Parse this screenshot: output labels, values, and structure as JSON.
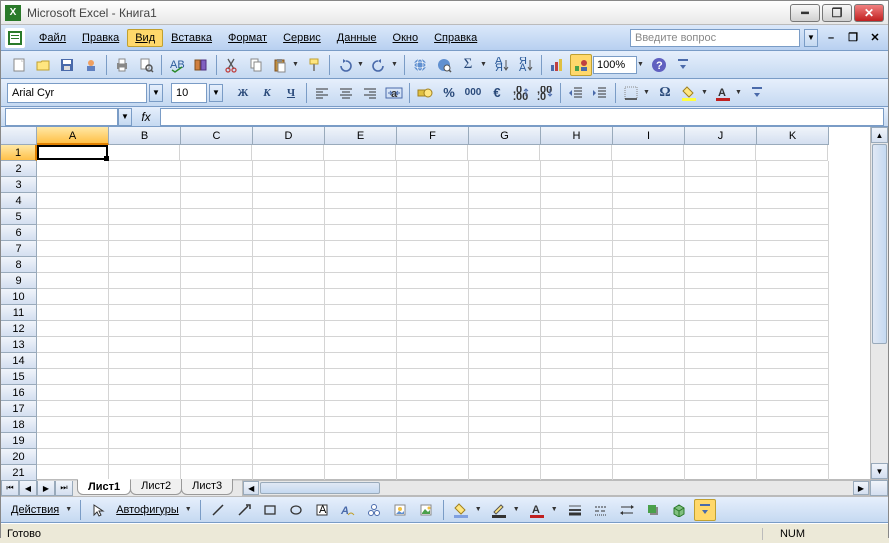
{
  "title": "Microsoft Excel - Книга1",
  "menu": {
    "items": [
      "Файл",
      "Правка",
      "Вид",
      "Вставка",
      "Формат",
      "Сервис",
      "Данные",
      "Окно",
      "Справка"
    ],
    "active_index": 2
  },
  "ask_box": {
    "placeholder": "Введите вопрос"
  },
  "toolbar": {
    "zoom": "100%"
  },
  "format": {
    "font": "Arial Cyr",
    "size": "10"
  },
  "name_box": {
    "value": ""
  },
  "formula": {
    "value": "",
    "fx": "fx"
  },
  "columns": [
    "A",
    "B",
    "C",
    "D",
    "E",
    "F",
    "G",
    "H",
    "I",
    "J",
    "K"
  ],
  "rows": [
    1,
    2,
    3,
    4,
    5,
    6,
    7,
    8,
    9,
    10,
    11,
    12,
    13,
    14,
    15,
    16,
    17,
    18,
    19,
    20,
    21
  ],
  "active_cell": {
    "row": 1,
    "col": "A"
  },
  "sheets": {
    "tabs": [
      "Лист1",
      "Лист2",
      "Лист3"
    ],
    "active_index": 0
  },
  "drawing": {
    "actions": "Действия",
    "autoshapes": "Автофигуры"
  },
  "status": {
    "ready": "Готово",
    "num": "NUM"
  }
}
